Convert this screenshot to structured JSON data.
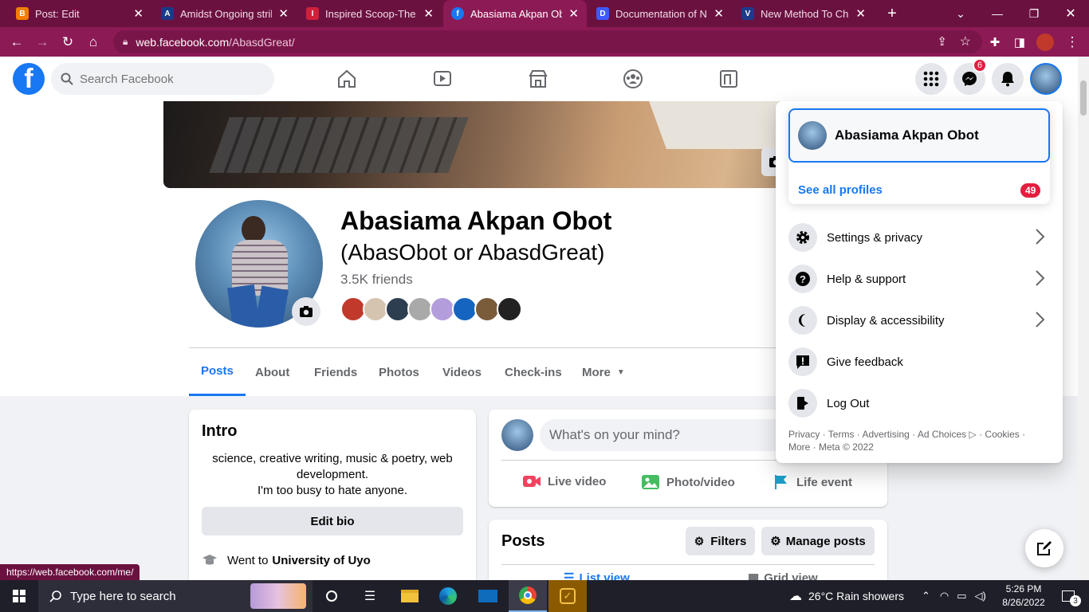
{
  "browser": {
    "tabs": [
      {
        "title": "Post: Edit",
        "favicon_color": "#f57d00",
        "favicon": "B"
      },
      {
        "title": "Amidst Ongoing strike",
        "favicon_color": "#1a3a8a",
        "favicon": "A"
      },
      {
        "title": "Inspired Scoop-The In",
        "favicon_color": "#d0203a",
        "favicon": "I"
      },
      {
        "title": "Abasiama Akpan Obo",
        "favicon_color": "#1877f2",
        "favicon": "f",
        "active": true
      },
      {
        "title": "Documentation of Ne",
        "favicon_color": "#3d5afe",
        "favicon": "D"
      },
      {
        "title": "New Method To Chan",
        "favicon_color": "#1e3a8a",
        "favicon": "V"
      }
    ],
    "new_tab": "+",
    "url_host": "web.facebook.com",
    "url_path": "/AbasdGreat/",
    "status_url": "https://web.facebook.com/me/"
  },
  "facebook": {
    "search_placeholder": "Search Facebook",
    "messenger_badge": "6",
    "profile": {
      "name": "Abasiama Akpan Obot",
      "alt_name": "(AbasObot or AbasdGreat)",
      "friends": "3.5K friends",
      "friend_avatar_colors": [
        "#c0392b",
        "#d5c4b0",
        "#2c3e50",
        "#a9a9a9",
        "#b39ddb",
        "#1565c0",
        "#7a5c3a",
        "#222222"
      ]
    },
    "profile_tabs": [
      "Posts",
      "About",
      "Friends",
      "Photos",
      "Videos",
      "Check-ins",
      "More"
    ],
    "intro": {
      "title": "Intro",
      "bio_line1": "science, creative writing, music & poetry, web",
      "bio_line2": "development.",
      "bio_line3": "I'm too busy to hate anyone.",
      "edit_bio": "Edit bio",
      "went_to_prefix": "Went to",
      "school": "University of Uyo"
    },
    "composer": {
      "placeholder": "What's on your mind?",
      "live": "Live video",
      "photo": "Photo/video",
      "life": "Life event"
    },
    "posts": {
      "title": "Posts",
      "filters": "Filters",
      "manage": "Manage posts",
      "list_view": "List view",
      "grid_view": "Grid view"
    },
    "account_menu": {
      "profile_name": "Abasiama Akpan Obot",
      "see_all": "See all profiles",
      "see_all_badge": "49",
      "items": [
        {
          "label": "Settings & privacy"
        },
        {
          "label": "Help & support"
        },
        {
          "label": "Display & accessibility"
        },
        {
          "label": "Give feedback"
        },
        {
          "label": "Log Out"
        }
      ],
      "footer_line1": "Privacy · Terms · Advertising · Ad Choices ▷ · Cookies ·",
      "footer_line2": "More · Meta © 2022"
    }
  },
  "taskbar": {
    "search_placeholder": "Type here to search",
    "weather": "26°C  Rain showers",
    "time": "5:26 PM",
    "date": "8/26/2022",
    "notif_count": "3"
  }
}
